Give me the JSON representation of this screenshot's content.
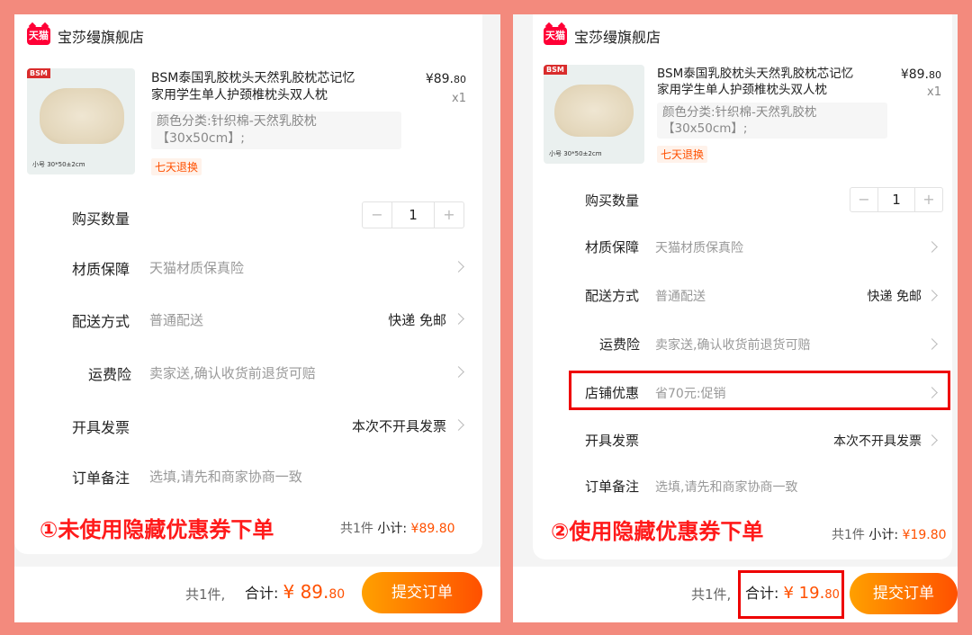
{
  "left": {
    "shop_logo": "天猫",
    "shop_name": "宝莎缦旗舰店",
    "product": {
      "brand_tag": "BSM",
      "size_note": "小号 30*50±2cm",
      "title_line1": "BSM泰国乳胶枕头天然乳胶枕芯记忆",
      "title_line2": "家用学生单人护颈椎枕头双人枕",
      "price_int": "¥89.",
      "price_dec": "80",
      "qty_mult": "x1",
      "spec_line1": "颜色分类:针织棉-天然乳胶枕",
      "spec_line2": "【30x50cm】;",
      "return_tag": "七天退换"
    },
    "rows": {
      "quantity_label": "购买数量",
      "quantity_value": "1",
      "minus": "−",
      "plus": "+",
      "material_label": "材质保障",
      "material_value": "天猫材质保真险",
      "delivery_label": "配送方式",
      "delivery_value": "普通配送",
      "delivery_right": "快递 免邮",
      "freight_label": "运费险",
      "freight_value": "卖家送,确认收货前退货可赔",
      "invoice_label": "开具发票",
      "invoice_right": "本次不开具发票",
      "remark_label": "订单备注",
      "remark_placeholder": "选填,请先和商家协商一致"
    },
    "annotation": "①未使用隐藏优惠券下单",
    "summary_count": "共1件",
    "summary_sub_label": "小计:",
    "summary_amount": "¥89.80",
    "bottom": {
      "count": "共1件,",
      "total_label": "合计:",
      "total_int": "¥ 89.",
      "total_dec": "80",
      "submit": "提交订单"
    }
  },
  "right": {
    "shop_logo": "天猫",
    "shop_name": "宝莎缦旗舰店",
    "product": {
      "brand_tag": "BSM",
      "size_note": "小号 30*50±2cm",
      "title_line1": "BSM泰国乳胶枕头天然乳胶枕芯记忆",
      "title_line2": "家用学生单人护颈椎枕头双人枕",
      "price_int": "¥89.",
      "price_dec": "80",
      "qty_mult": "x1",
      "spec_line1": "颜色分类:针织棉-天然乳胶枕",
      "spec_line2": "【30x50cm】;",
      "return_tag": "七天退换"
    },
    "rows": {
      "quantity_label": "购买数量",
      "quantity_value": "1",
      "minus": "−",
      "plus": "+",
      "material_label": "材质保障",
      "material_value": "天猫材质保真险",
      "delivery_label": "配送方式",
      "delivery_value": "普通配送",
      "delivery_right": "快递 免邮",
      "freight_label": "运费险",
      "freight_value": "卖家送,确认收货前退货可赔",
      "discount_label": "店铺优惠",
      "discount_value": "省70元:促销",
      "invoice_label": "开具发票",
      "invoice_right": "本次不开具发票",
      "remark_label": "订单备注",
      "remark_placeholder": "选填,请先和商家协商一致"
    },
    "annotation": "②使用隐藏优惠券下单",
    "summary_count": "共1件",
    "summary_sub_label": "小计:",
    "summary_amount": "¥19.80",
    "bottom": {
      "count": "共1件,",
      "total_label": "合计:",
      "total_int": "¥ 19.",
      "total_dec": "80",
      "submit": "提交订单"
    }
  },
  "colors": {
    "background": "#f38a7d",
    "accent": "#ff5000",
    "highlight_box": "#ee0000",
    "tmall_red": "#ff0036"
  }
}
